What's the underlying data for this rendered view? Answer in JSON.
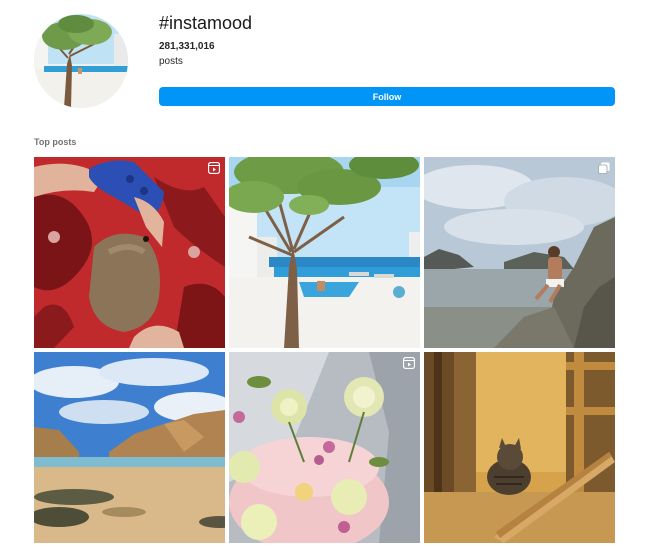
{
  "header": {
    "hashtag": "#instamood",
    "post_count": "281,331,016",
    "posts_label": "posts",
    "follow_label": "Follow"
  },
  "top_posts": {
    "section_label": "Top posts",
    "items": [
      {
        "description": "",
        "badge": "reel-icon"
      },
      {
        "description": "",
        "badge": null
      },
      {
        "description": "",
        "badge": "carousel-icon"
      },
      {
        "description": "",
        "badge": null
      },
      {
        "description": "",
        "badge": "reel-icon"
      },
      {
        "description": "",
        "badge": null
      }
    ]
  },
  "colors": {
    "accent": "#0095f6",
    "text": "#262626",
    "muted": "#737373"
  }
}
